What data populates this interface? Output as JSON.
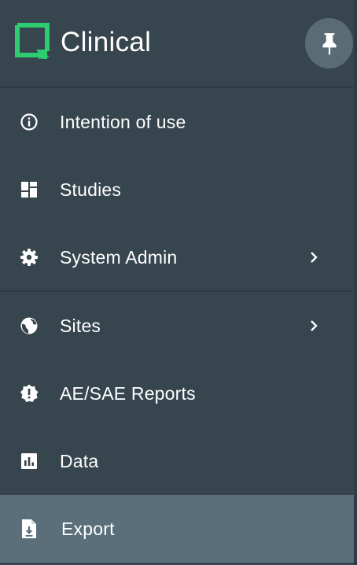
{
  "app": {
    "title": "Clinical",
    "accent_color": "#2ecc71",
    "logo_icon": "square-arrow-logo-icon",
    "pin_icon": "pushpin-icon"
  },
  "menu": {
    "items": [
      {
        "label": "Intention of use",
        "icon": "info-circle-icon",
        "has_submenu": false,
        "active": false
      },
      {
        "label": "Studies",
        "icon": "dashboard-icon",
        "has_submenu": false,
        "active": false
      },
      {
        "label": "System Admin",
        "icon": "gear-icon",
        "has_submenu": true,
        "active": false
      },
      {
        "label": "Sites",
        "icon": "globe-icon",
        "has_submenu": true,
        "active": false
      },
      {
        "label": "AE/SAE Reports",
        "icon": "alert-badge-icon",
        "has_submenu": false,
        "active": false
      },
      {
        "label": "Data",
        "icon": "bar-chart-icon",
        "has_submenu": false,
        "active": false
      },
      {
        "label": "Export",
        "icon": "file-download-icon",
        "has_submenu": false,
        "active": true
      }
    ]
  }
}
